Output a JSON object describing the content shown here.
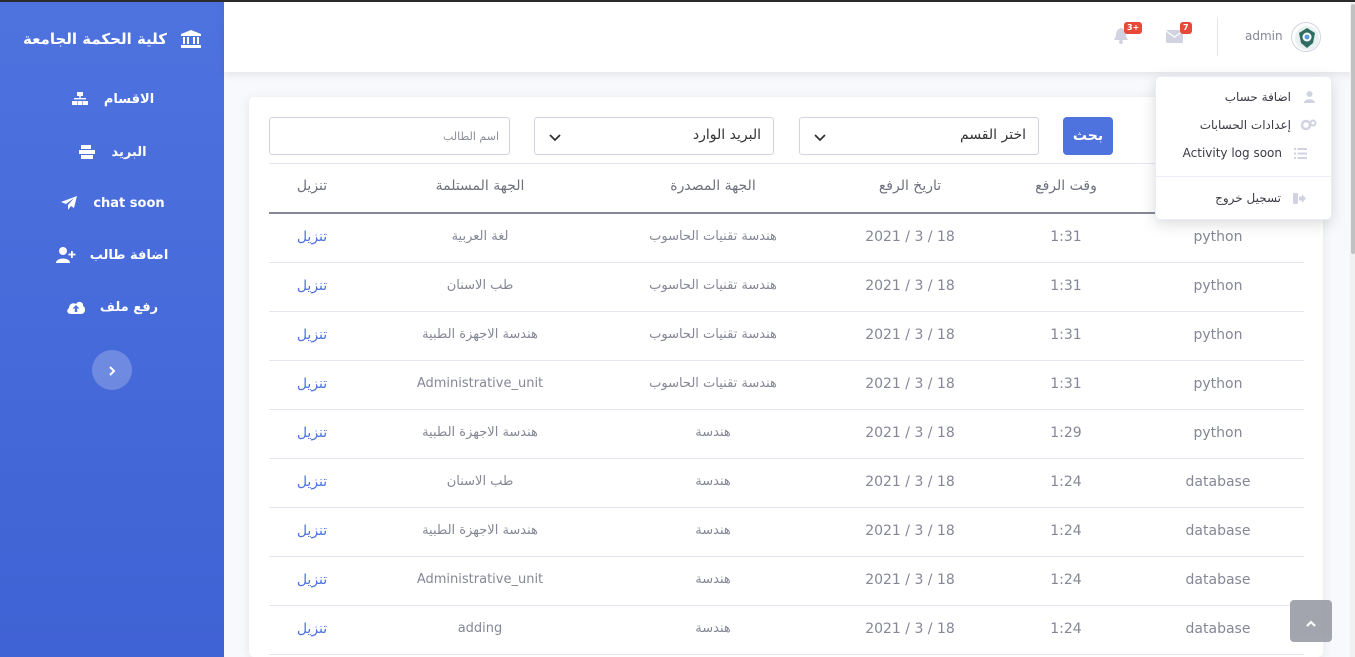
{
  "brand": {
    "title": "كلية الحكمة الجامعة",
    "icon": "university-icon"
  },
  "sidebar": {
    "items": [
      {
        "label": "الاقسام",
        "icon": "sitemap-icon"
      },
      {
        "label": "البريد",
        "icon": "mail-tray-icon"
      },
      {
        "label": "chat soon",
        "icon": "paper-plane-icon"
      },
      {
        "label": "اضافة طالب",
        "icon": "user-plus-icon"
      },
      {
        "label": "رفع ملف",
        "icon": "cloud-upload-icon"
      }
    ],
    "toggle_icon": "chevron-right-icon"
  },
  "topbar": {
    "alerts_badge": "3+",
    "messages_badge": "7",
    "user_name": "admin"
  },
  "filters": {
    "search_button": "بحث",
    "department_select": "اختر القسم",
    "mailbox_select": "البريد الوارد",
    "student_name_placeholder": "اسم الطالب"
  },
  "table": {
    "headers": {
      "subject": "",
      "time": "وقت الرفع",
      "date": "تاريخ الرفع",
      "sender": "الجهة المصدرة",
      "receiver": "الجهة المستلمة",
      "download": "تنزيل"
    },
    "rows": [
      {
        "subject": "python",
        "time": "1:31",
        "date": "2021 / 3 / 18",
        "sender": "هندسة تقنيات الحاسوب",
        "receiver": "لغة العربية",
        "download": "تنزيل"
      },
      {
        "subject": "python",
        "time": "1:31",
        "date": "2021 / 3 / 18",
        "sender": "هندسة تقنيات الحاسوب",
        "receiver": "طب الاسنان",
        "download": "تنزيل"
      },
      {
        "subject": "python",
        "time": "1:31",
        "date": "2021 / 3 / 18",
        "sender": "هندسة تقنيات الحاسوب",
        "receiver": "هندسة الاجهزة الطبية",
        "download": "تنزيل"
      },
      {
        "subject": "python",
        "time": "1:31",
        "date": "2021 / 3 / 18",
        "sender": "هندسة تقنيات الحاسوب",
        "receiver": "Administrative_unit",
        "download": "تنزيل"
      },
      {
        "subject": "python",
        "time": "1:29",
        "date": "2021 / 3 / 18",
        "sender": "هندسة",
        "receiver": "هندسة الاجهزة الطبية",
        "download": "تنزيل"
      },
      {
        "subject": "database",
        "time": "1:24",
        "date": "2021 / 3 / 18",
        "sender": "هندسة",
        "receiver": "طب الاسنان",
        "download": "تنزيل"
      },
      {
        "subject": "database",
        "time": "1:24",
        "date": "2021 / 3 / 18",
        "sender": "هندسة",
        "receiver": "هندسة الاجهزة الطبية",
        "download": "تنزيل"
      },
      {
        "subject": "database",
        "time": "1:24",
        "date": "2021 / 3 / 18",
        "sender": "هندسة",
        "receiver": "Administrative_unit",
        "download": "تنزيل"
      },
      {
        "subject": "database",
        "time": "1:24",
        "date": "2021 / 3 / 18",
        "sender": "هندسة",
        "receiver": "adding",
        "download": "تنزيل"
      }
    ]
  },
  "user_menu": {
    "items": [
      {
        "label": "اضافة حساب",
        "icon": "user-icon"
      },
      {
        "label": "إعدادات الحسابات",
        "icon": "cogs-icon"
      },
      {
        "label": "Activity log soon",
        "icon": "list-icon"
      }
    ],
    "logout": {
      "label": "تسجيل خروج",
      "icon": "sign-out-icon"
    }
  },
  "colors": {
    "primary": "#4e73df",
    "sidebar": "#4e73df",
    "badge": "#e74a3b",
    "text_muted": "#858796"
  }
}
